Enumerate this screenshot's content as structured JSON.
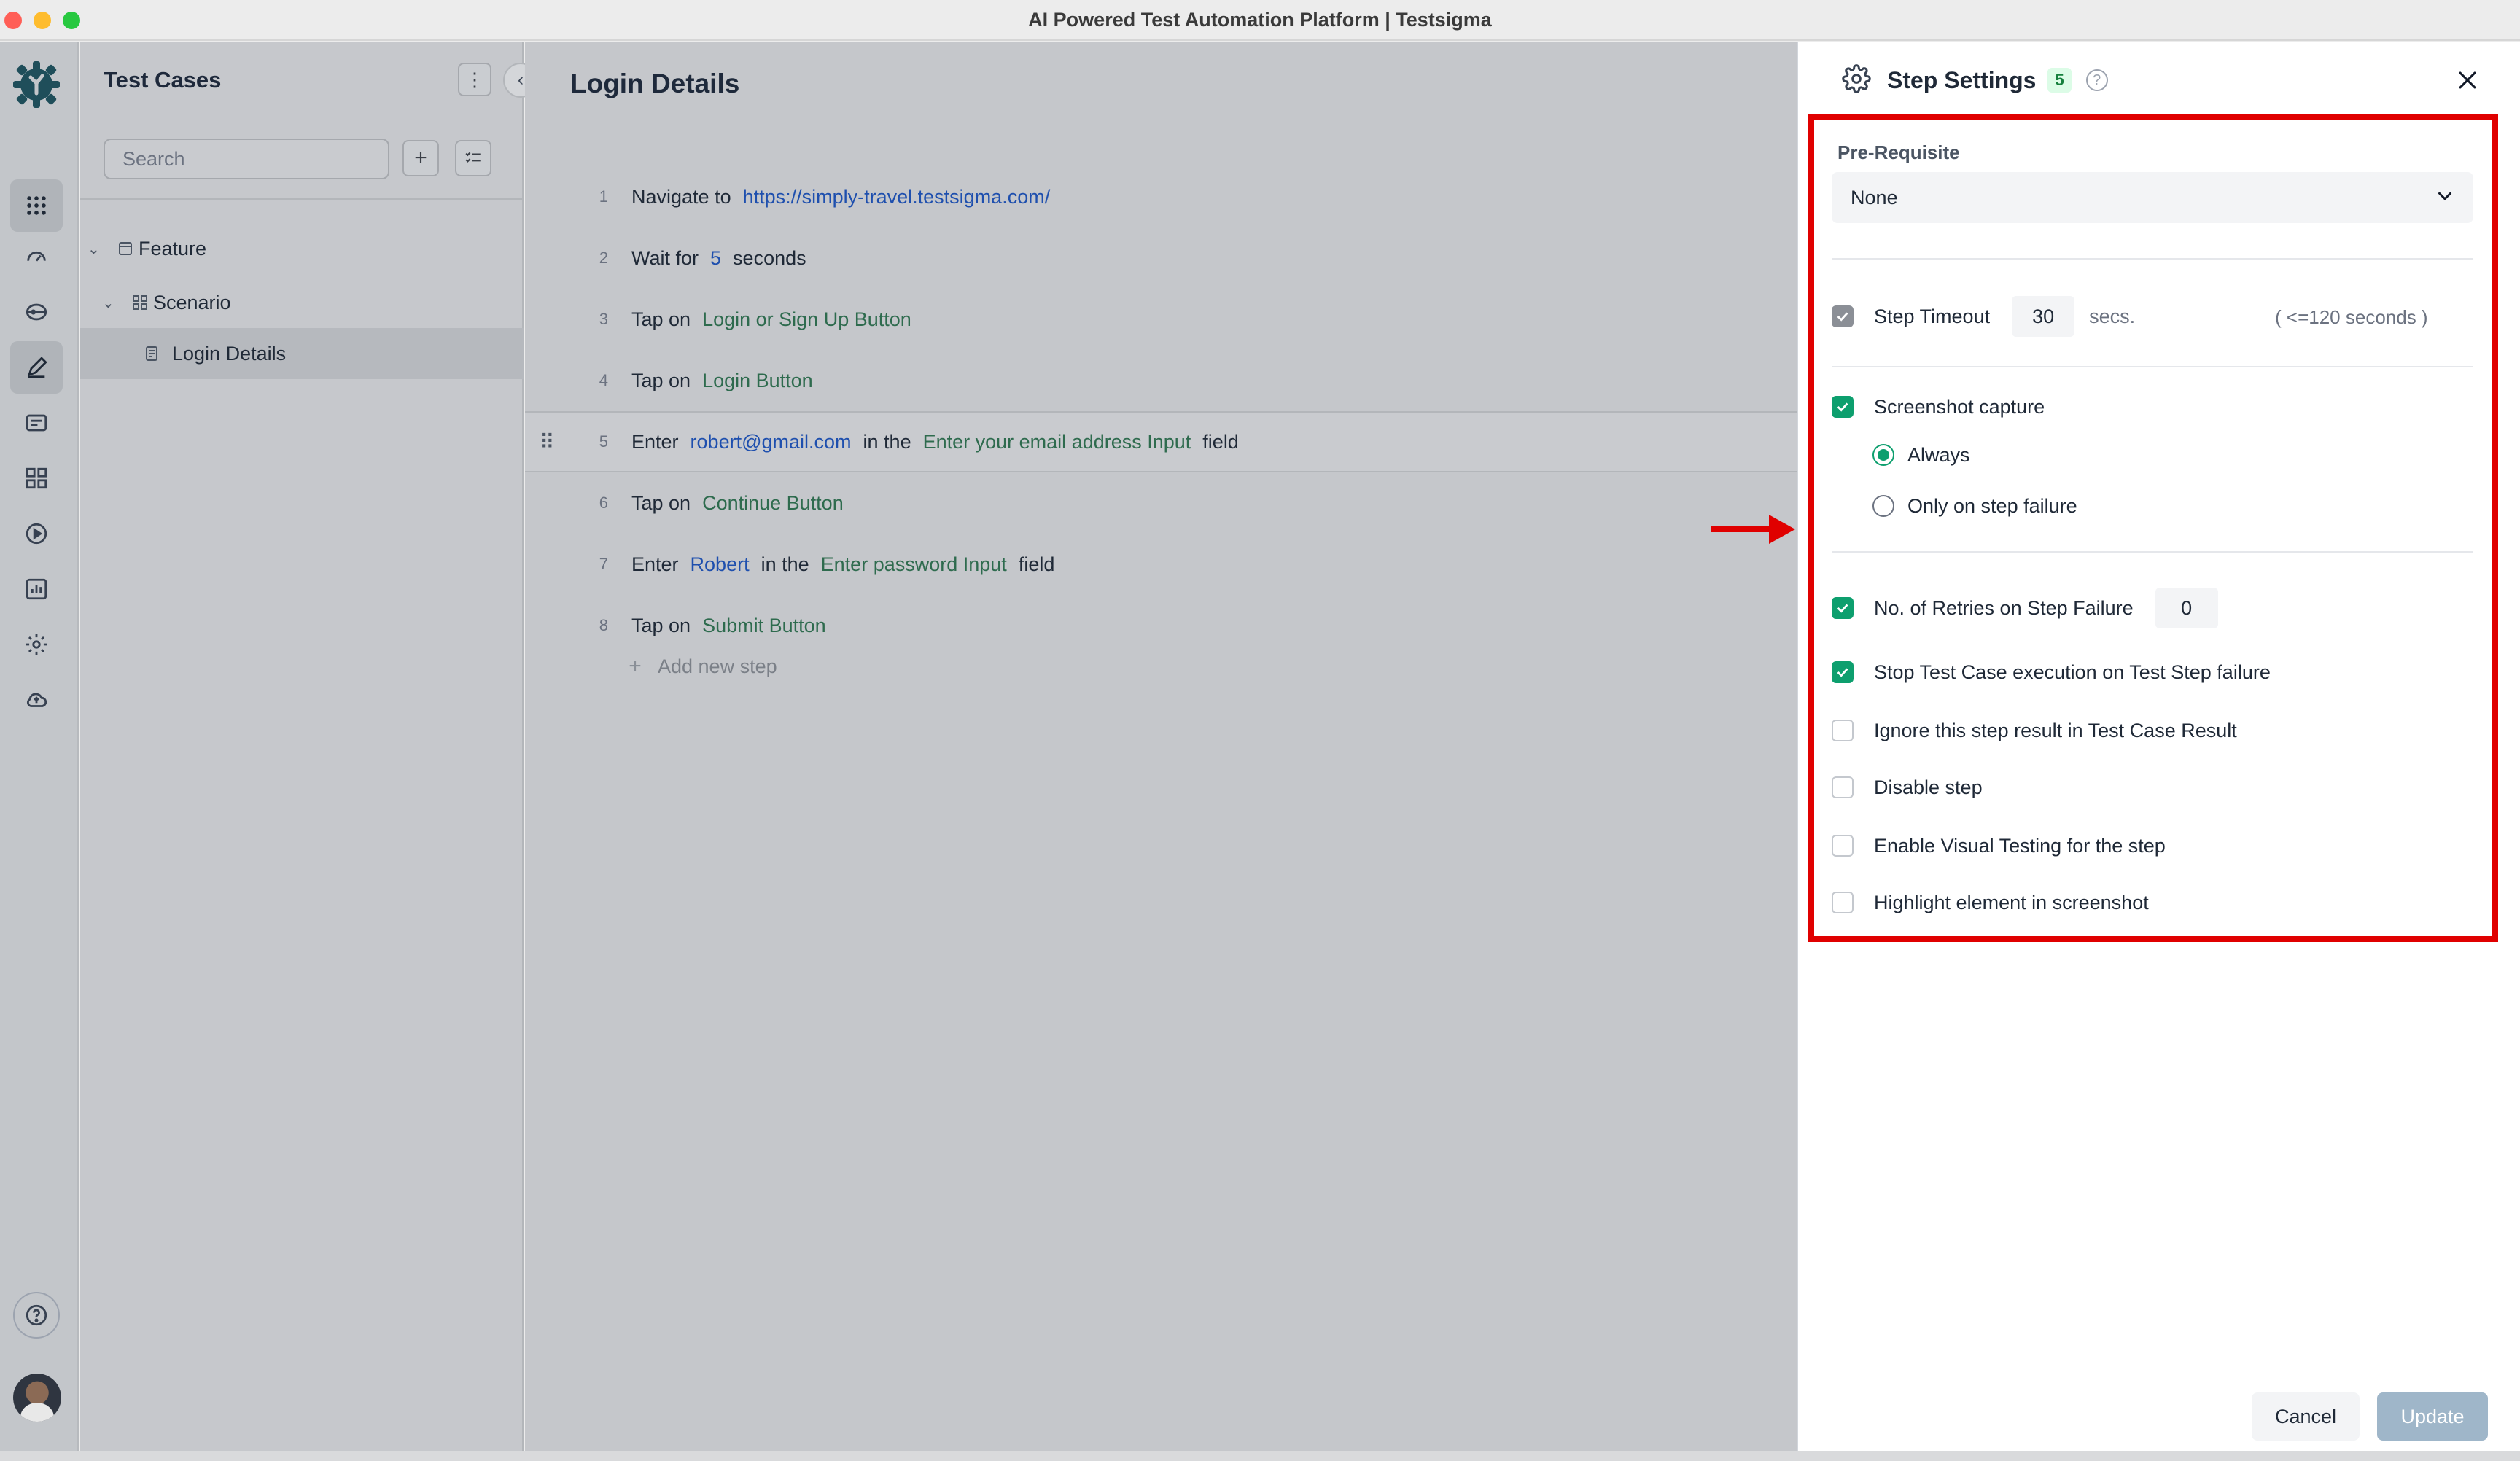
{
  "window": {
    "title": "AI Powered Test Automation Platform | Testsigma"
  },
  "nav": {
    "items": [
      "apps-grid-icon",
      "dashboard-icon",
      "test-data-icon",
      "test-cases-icon",
      "test-plans-icon",
      "components-icon",
      "runs-icon",
      "reports-icon",
      "settings-icon",
      "uploads-icon"
    ],
    "help_icon": "help-icon"
  },
  "test_cases_panel": {
    "title": "Test Cases",
    "search_placeholder": "Search",
    "tree": [
      {
        "label": "Feature",
        "type": "feature"
      },
      {
        "label": "Scenario",
        "type": "scenario"
      },
      {
        "label": "Login Details",
        "type": "test-case",
        "selected": true
      }
    ]
  },
  "main": {
    "title": "Login Details",
    "steps": [
      {
        "num": "1",
        "parts": [
          {
            "t": "txt",
            "v": "Navigate to"
          },
          {
            "t": "url",
            "v": "https://simply-travel.testsigma.com/"
          }
        ]
      },
      {
        "num": "2",
        "parts": [
          {
            "t": "txt",
            "v": "Wait for"
          },
          {
            "t": "val",
            "v": "5"
          },
          {
            "t": "txt",
            "v": "seconds"
          }
        ]
      },
      {
        "num": "3",
        "parts": [
          {
            "t": "txt",
            "v": "Tap on"
          },
          {
            "t": "el",
            "v": "Login or Sign Up Button"
          }
        ]
      },
      {
        "num": "4",
        "parts": [
          {
            "t": "txt",
            "v": "Tap on"
          },
          {
            "t": "el",
            "v": "Login Button"
          }
        ]
      },
      {
        "num": "5",
        "parts": [
          {
            "t": "txt",
            "v": "Enter"
          },
          {
            "t": "val",
            "v": "robert@gmail.com"
          },
          {
            "t": "txt",
            "v": "in the"
          },
          {
            "t": "el",
            "v": "Enter your email address Input"
          },
          {
            "t": "txt",
            "v": "field"
          }
        ]
      },
      {
        "num": "6",
        "parts": [
          {
            "t": "txt",
            "v": "Tap on"
          },
          {
            "t": "el",
            "v": "Continue Button"
          }
        ]
      },
      {
        "num": "7",
        "parts": [
          {
            "t": "txt",
            "v": "Enter"
          },
          {
            "t": "val",
            "v": "Robert"
          },
          {
            "t": "txt",
            "v": "in the"
          },
          {
            "t": "el",
            "v": "Enter password Input"
          },
          {
            "t": "txt",
            "v": "field"
          }
        ]
      },
      {
        "num": "8",
        "parts": [
          {
            "t": "txt",
            "v": "Tap on"
          },
          {
            "t": "el",
            "v": "Submit Button"
          }
        ]
      }
    ],
    "add_step": "Add new step"
  },
  "step_settings": {
    "title": "Step Settings",
    "badge": "5",
    "help": "?",
    "pre_requisite_label": "Pre-Requisite",
    "pre_requisite_value": "None",
    "step_timeout_label": "Step Timeout",
    "step_timeout_value": "30",
    "step_timeout_unit": "secs.",
    "step_timeout_limit": "( <=120 seconds )",
    "screenshot_capture_label": "Screenshot capture",
    "screenshot_options": [
      "Always",
      "Only on step failure"
    ],
    "screenshot_selected": "Always",
    "retries_label": "No. of Retries on Step Failure",
    "retries_value": "0",
    "stop_on_failure_label": "Stop Test Case execution on Test Step failure",
    "ignore_result_label": "Ignore this step result in Test Case Result",
    "disable_step_label": "Disable step",
    "visual_testing_label": "Enable Visual Testing for the step",
    "highlight_label": "Highlight element in screenshot",
    "cancel_label": "Cancel",
    "update_label": "Update"
  },
  "colors": {
    "accent_green": "#0d9f6e",
    "annotation_red": "#e00000",
    "link_blue": "#1e4fae",
    "element_green": "#2e6b4e"
  }
}
